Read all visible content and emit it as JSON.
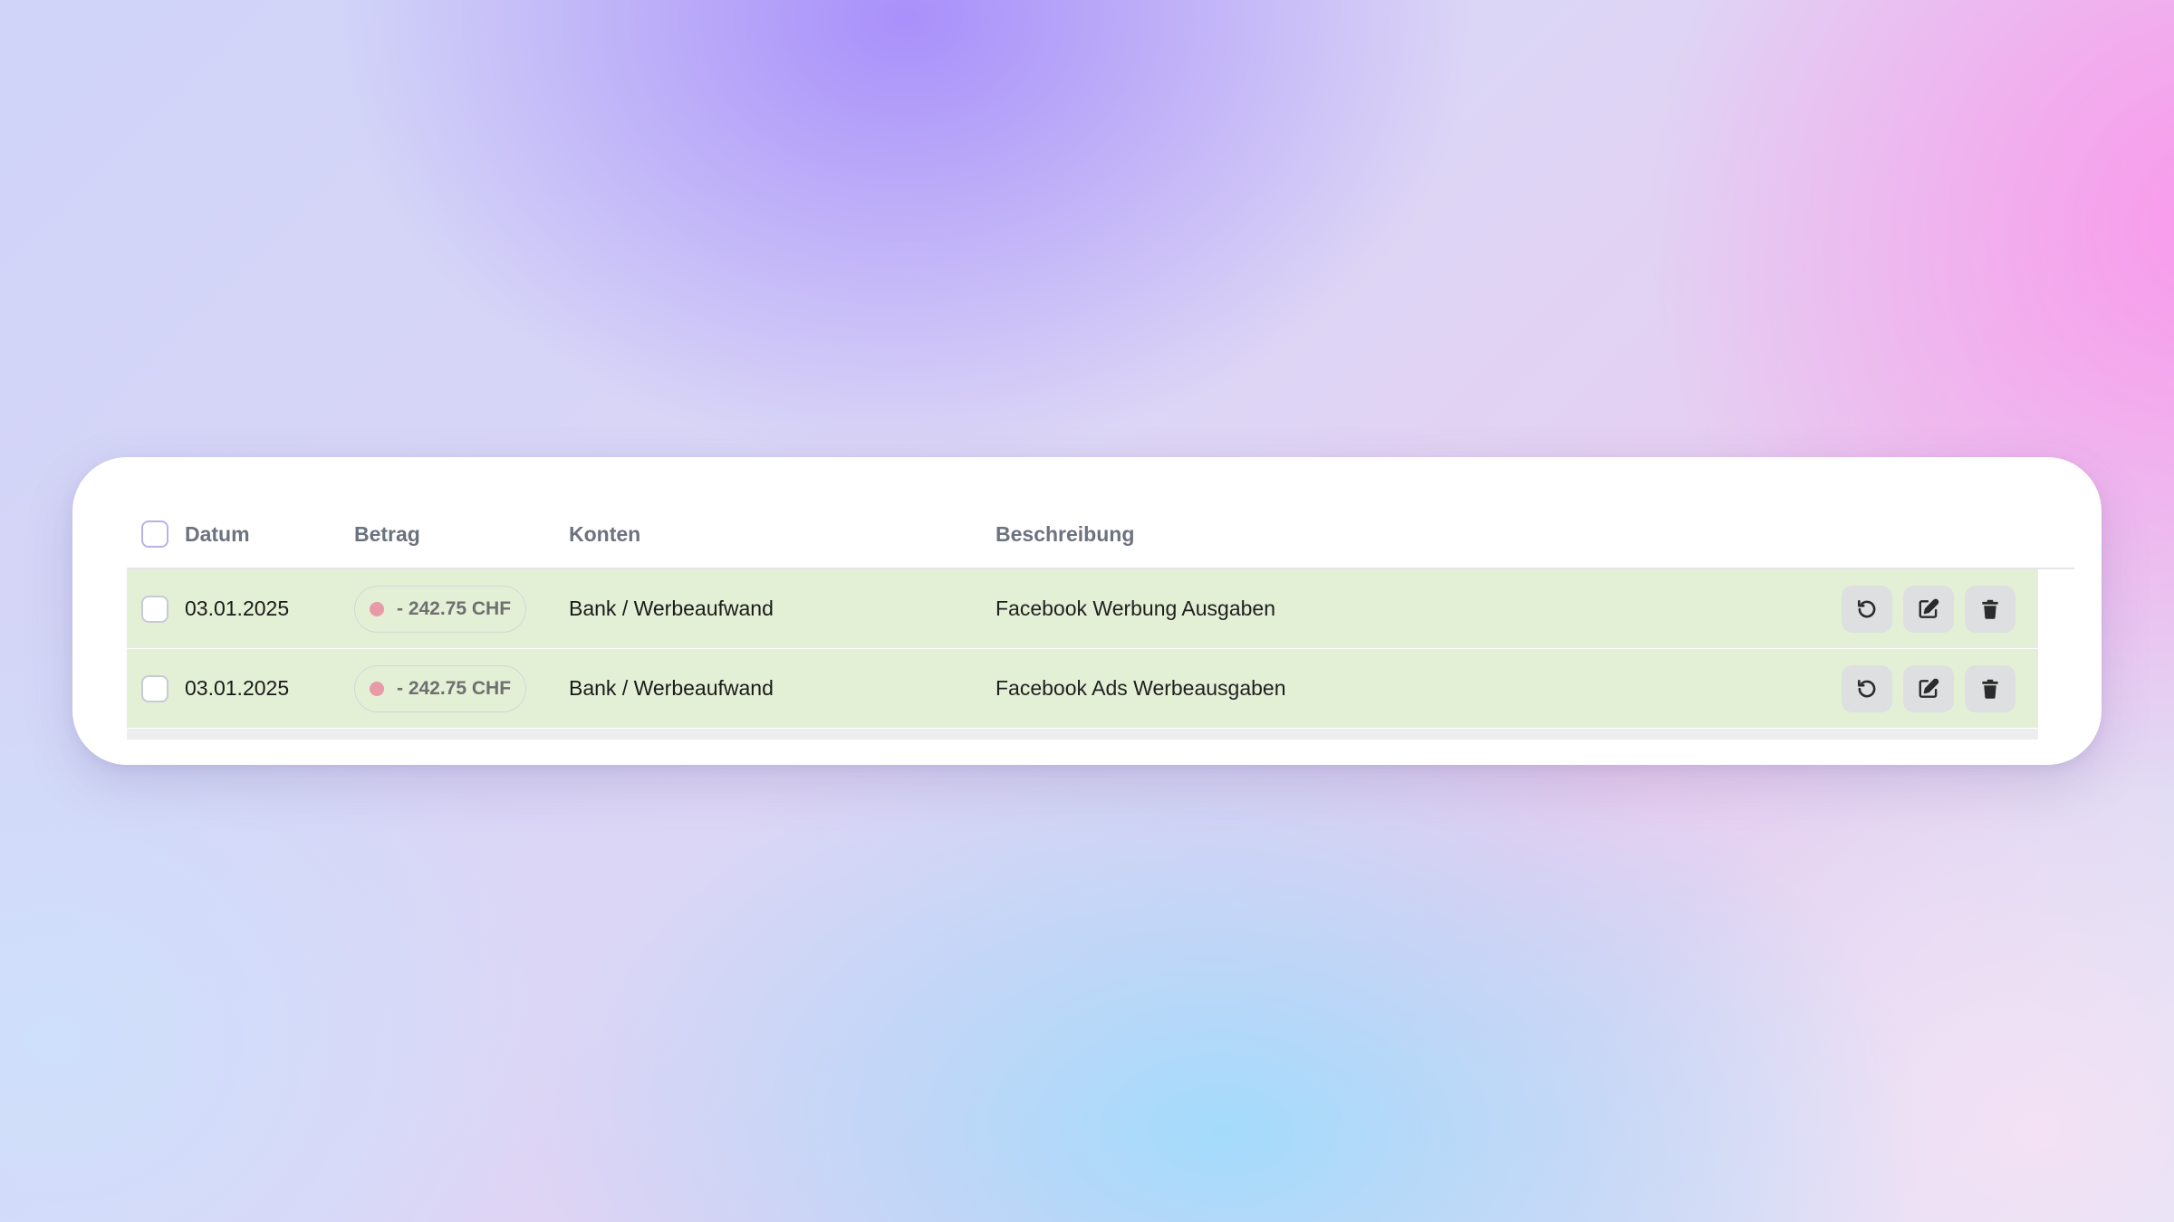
{
  "table": {
    "headers": {
      "datum": "Datum",
      "betrag": "Betrag",
      "konten": "Konten",
      "beschreibung": "Beschreibung"
    },
    "rows": [
      {
        "datum": "03.01.2025",
        "betrag": "- 242.75 CHF",
        "konten": "Bank / Werbeaufwand",
        "beschreibung": "Facebook Werbung Ausgaben"
      },
      {
        "datum": "03.01.2025",
        "betrag": "- 242.75 CHF",
        "konten": "Bank / Werbeaufwand",
        "beschreibung": "Facebook Ads Werbeausgaben"
      }
    ]
  },
  "icons": {
    "row_actions": [
      "undo-icon",
      "edit-icon",
      "trash-icon"
    ]
  },
  "colors": {
    "row_highlight": "#e3f0d6",
    "negative_dot": "#e89aa6",
    "checkbox_header_border": "#b8b2e8"
  }
}
